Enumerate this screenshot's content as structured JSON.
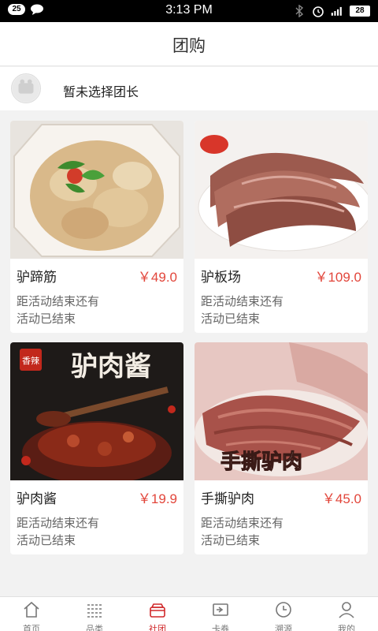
{
  "status_bar": {
    "notif_count": "25",
    "time": "3:13 PM",
    "battery": "28"
  },
  "header": {
    "title": "团购"
  },
  "leader": {
    "label": "暂未选择团长"
  },
  "products": [
    {
      "name": "驴蹄筋",
      "price": "￥49.0",
      "countdown_label": "距活动结束还有",
      "status": "活动已结束"
    },
    {
      "name": "驴板场",
      "price": "￥109.0",
      "countdown_label": "距活动结束还有",
      "status": "活动已结束"
    },
    {
      "name": "驴肉酱",
      "price": "￥19.9",
      "countdown_label": "距活动结束还有",
      "status": "活动已结束"
    },
    {
      "name": "手撕驴肉",
      "price": "￥45.0",
      "countdown_label": "距活动结束还有",
      "status": "活动已结束"
    }
  ],
  "product_images": [
    {
      "banner": ""
    },
    {
      "banner": ""
    },
    {
      "banner_tag": "香辣",
      "banner": "驴肉酱"
    },
    {
      "banner": "手撕驴肉"
    }
  ],
  "tabs": [
    {
      "label": "首页",
      "icon": "home-icon"
    },
    {
      "label": "品类",
      "icon": "list-icon"
    },
    {
      "label": "社团",
      "icon": "group-icon",
      "active": true
    },
    {
      "label": "卡券",
      "icon": "coupon-icon"
    },
    {
      "label": "溯源",
      "icon": "clock-icon"
    },
    {
      "label": "我的",
      "icon": "user-icon"
    }
  ],
  "colors": {
    "accent": "#d0282a",
    "price": "#e2463b",
    "background": "#f2f2f2"
  }
}
